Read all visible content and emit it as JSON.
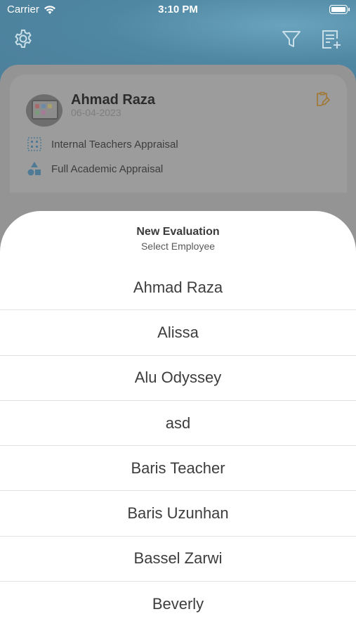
{
  "status_bar": {
    "carrier": "Carrier",
    "time": "3:10 PM"
  },
  "toolbar": {
    "settings_icon": "gear-icon",
    "filter_icon": "filter-icon",
    "add_icon": "add-document-icon"
  },
  "card": {
    "name": "Ahmad Raza",
    "date": "06-04-2023",
    "type": "Internal Teachers Appraisal",
    "template": "Full Academic Appraisal",
    "edit_icon": "edit-clipboard-icon",
    "accent_color": "#e8a33a"
  },
  "sheet": {
    "title": "New Evaluation",
    "subtitle": "Select Employee",
    "employees": [
      "Ahmad Raza",
      "Alissa",
      "Alu Odyssey",
      "asd",
      "Baris Teacher",
      "Baris Uzunhan",
      "Bassel Zarwi",
      "Beverly"
    ]
  },
  "colors": {
    "header": "#4f86a2",
    "sheet_background": "#ffffff",
    "text": "#3d3d3d",
    "icon_blue": "#4a90c8"
  }
}
